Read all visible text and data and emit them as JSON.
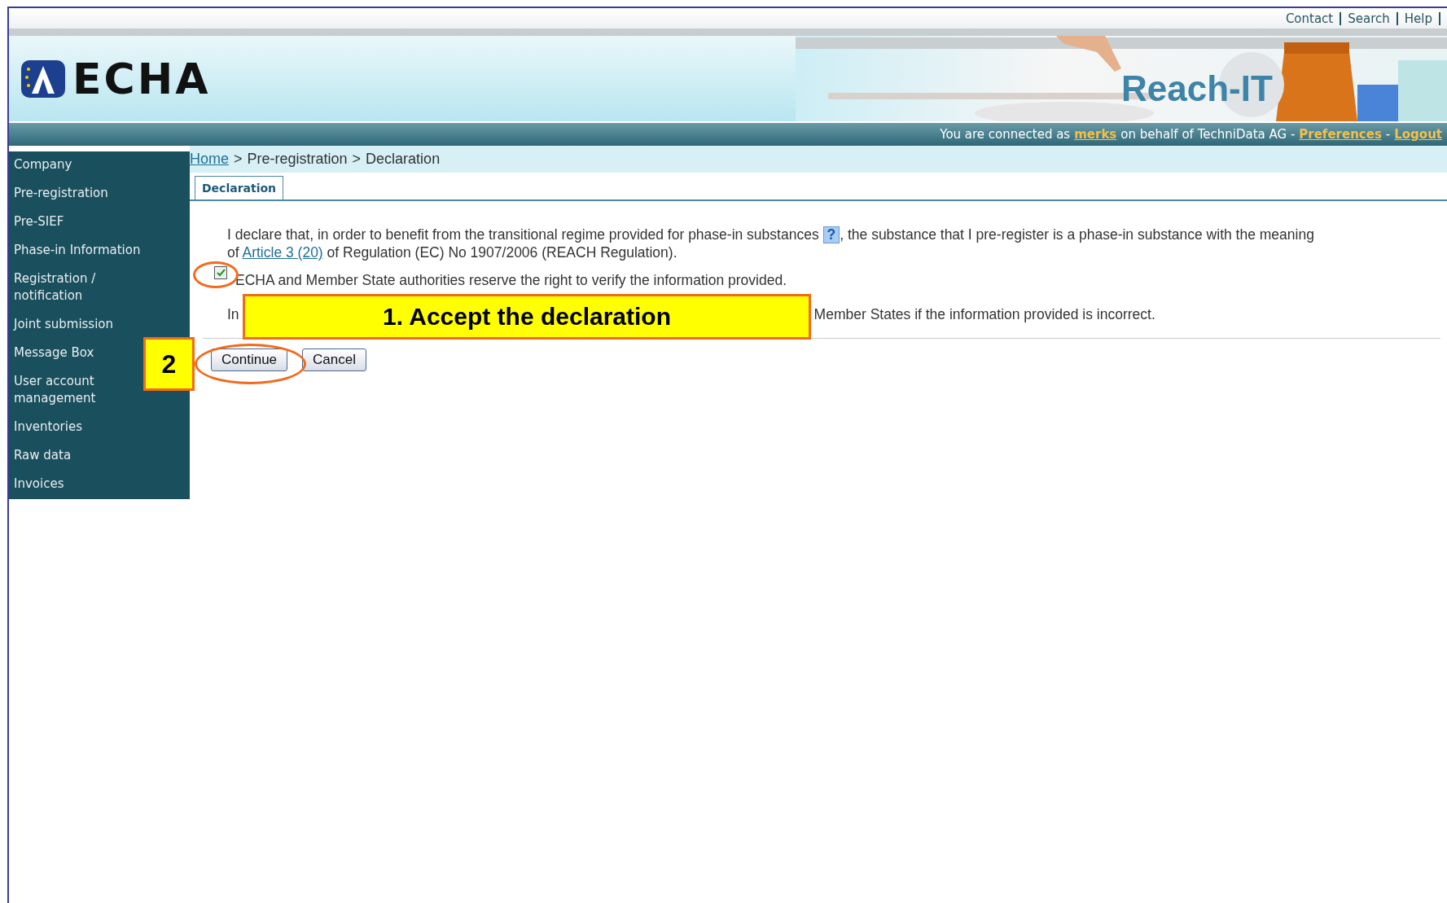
{
  "header": {
    "links": [
      "Contact",
      "Search",
      "Help"
    ],
    "logo": "ECHA",
    "product": "Reach-IT",
    "status": {
      "prefix": "You are connected as",
      "user": "merks",
      "middle": "on behalf of TechniData AG -",
      "preferences": "Preferences",
      "separator": "-",
      "logout": "Logout"
    }
  },
  "sidebar": {
    "items": [
      "Company",
      "Pre-registration",
      "Pre-SIEF",
      "Phase-in Information",
      "Registration / notification",
      "Joint submission",
      "Message Box",
      "User account management",
      "Inventories",
      "Raw data",
      "Invoices"
    ]
  },
  "breadcrumb": {
    "separator": ">",
    "items": [
      {
        "label": "Home",
        "link": true
      },
      {
        "label": "Pre-registration",
        "link": false
      },
      {
        "label": "Declaration",
        "link": false
      }
    ]
  },
  "tabs": [
    {
      "label": "Declaration",
      "selected": true
    }
  ],
  "declaration": {
    "text_before": "I declare that, in order to benefit from the transitional regime provided for phase-in substances",
    "help": "?",
    "text_after": ", the substance that I pre-register is a phase-in substance with the meaning of",
    "link": "Article 3 (20)",
    "text_end": "of Regulation (EC) No 1907/2006 (REACH Regulation)."
  },
  "checkbox": {
    "checked": true,
    "label": "ECHA and Member State authorities reserve the right to verify the information provided."
  },
  "notice": [
    "In",
    "Member States if the information provided is incorrect."
  ],
  "buttons": [
    "Continue",
    "Cancel"
  ],
  "annotations": [
    "1. Accept the declaration",
    "2"
  ]
}
